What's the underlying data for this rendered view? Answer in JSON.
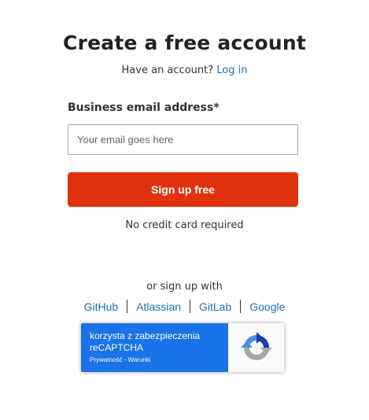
{
  "heading": "Create a free account",
  "account": {
    "prompt": "Have an account?",
    "login_link": "Log in"
  },
  "form": {
    "email_label": "Business email address*",
    "email_placeholder": "Your email goes here",
    "email_value": "",
    "submit_label": "Sign up free",
    "note": "No credit card required"
  },
  "alt_signup": {
    "label": "or sign up with",
    "providers": [
      "GitHub",
      "Atlassian",
      "GitLab",
      "Google"
    ]
  },
  "recaptcha": {
    "line1": "korzysta z zabezpieczenia",
    "line2": "reCAPTCHA",
    "links": "Prywatność - Warunki",
    "icon": "recaptcha-logo-icon"
  },
  "colors": {
    "primary_button": "#e13210",
    "link": "#1f6fb2",
    "recaptcha_badge": "#1a73e8"
  }
}
